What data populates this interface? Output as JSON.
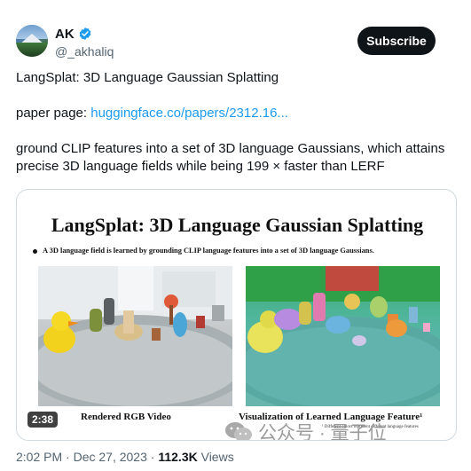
{
  "author": {
    "display_name": "AK",
    "handle": "@_akhaliq",
    "verified": true
  },
  "subscribe_label": "Subscribe",
  "tweet": {
    "title_line": "LangSplat: 3D Language Gaussian Splatting",
    "paper_prefix": "paper page: ",
    "paper_link": "huggingface.co/papers/2312.16...",
    "body_line1": "ground CLIP features into a set of 3D language Gaussians, which attains",
    "body_line2": "precise 3D language fields while being 199 × faster than LERF"
  },
  "media": {
    "slide_title": "LangSplat: 3D Language Gaussian Splatting",
    "slide_bullet": "A 3D language field is learned by grounding CLIP language features into a set of 3D language Gaussians.",
    "caption_left": "Rendered RGB Video",
    "caption_right": "Visualization of Learned Language Feature¹",
    "footnote": "¹ Different colors represent different language features",
    "duration": "2:38",
    "watermark": "公众号 · 量子位"
  },
  "meta": {
    "time": "2:02 PM",
    "separator": " · ",
    "date": "Dec 27, 2023",
    "views_count": "112.3K",
    "views_label": " Views"
  },
  "colors": {
    "link": "#1d9bf0",
    "verified": "#1d9bf0",
    "subscribe_bg": "#0f1419"
  }
}
